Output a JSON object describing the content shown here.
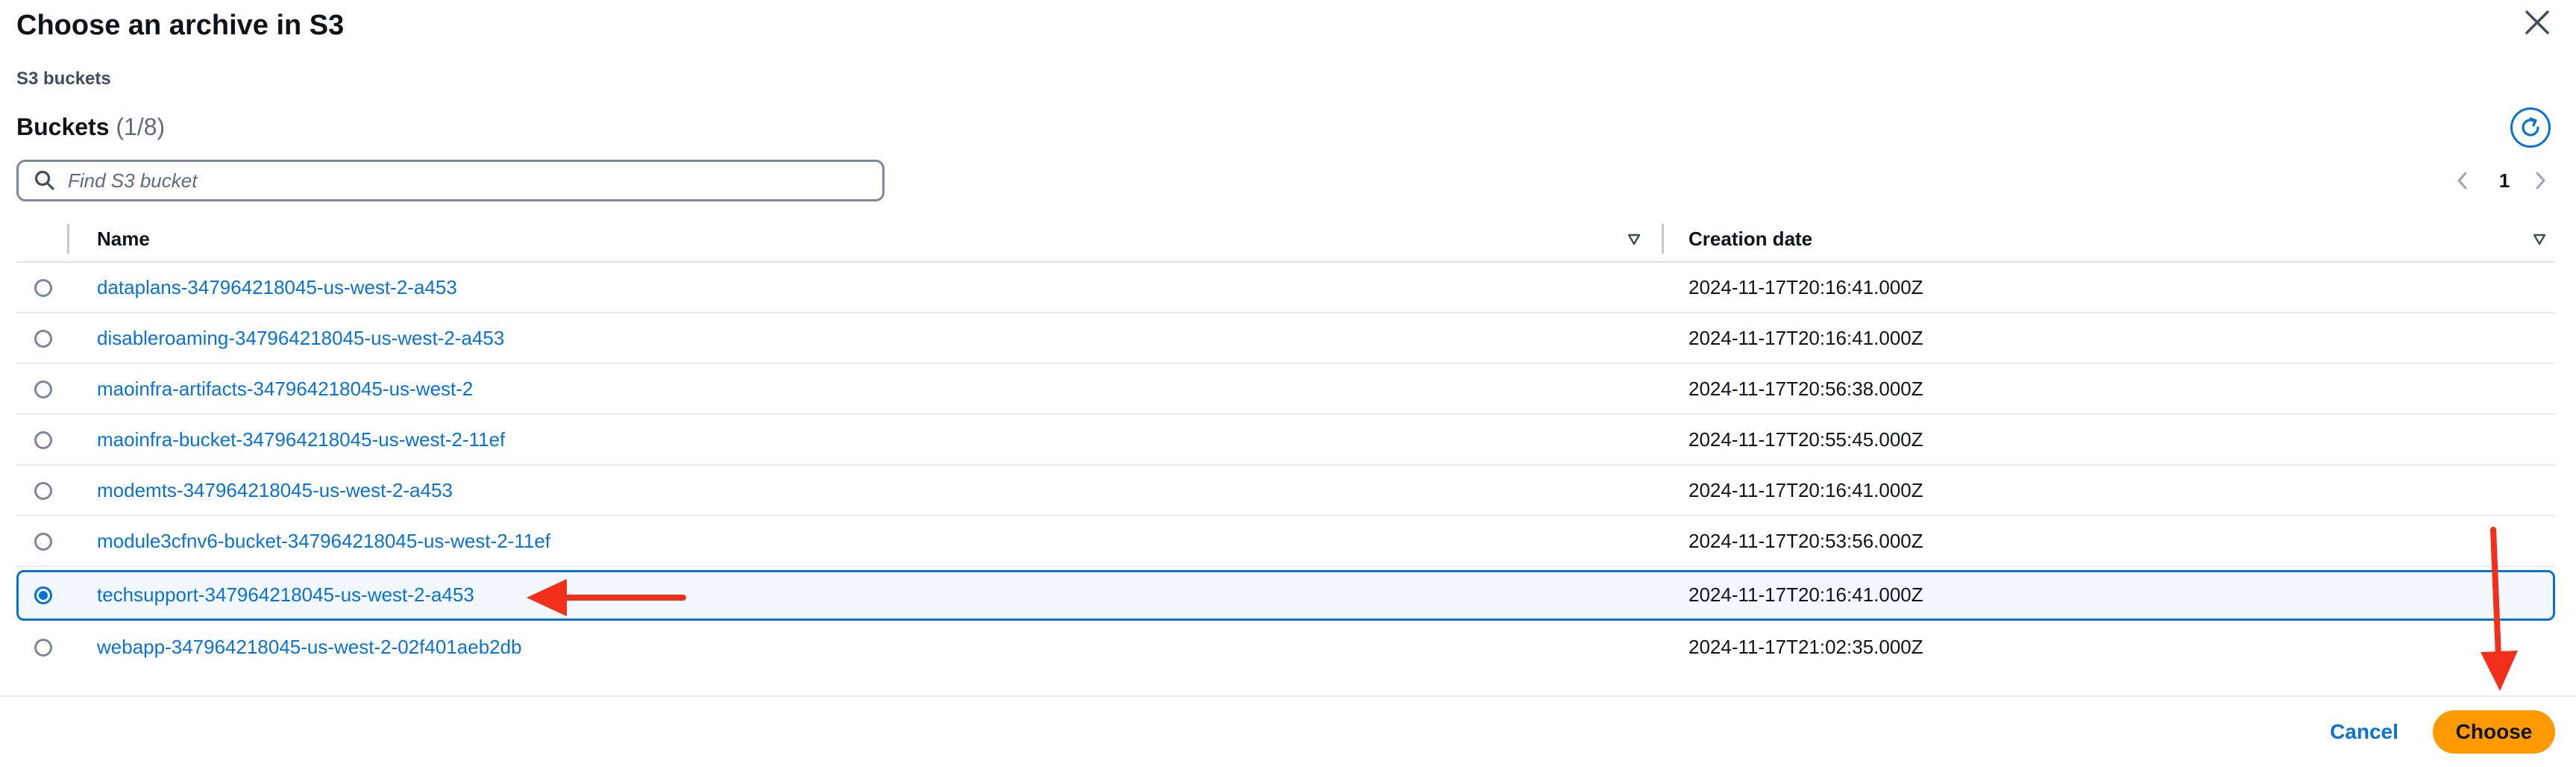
{
  "modal": {
    "title": "Choose an archive in S3"
  },
  "breadcrumb": "S3 buckets",
  "section": {
    "title": "Buckets",
    "count": "(1/8)"
  },
  "search": {
    "placeholder": "Find S3 bucket",
    "value": ""
  },
  "pagination": {
    "current_page": "1"
  },
  "table": {
    "columns": [
      "Name",
      "Creation date"
    ],
    "rows": [
      {
        "name": "dataplans-347964218045-us-west-2-a453",
        "created": "2024-11-17T20:16:41.000Z",
        "selected": false
      },
      {
        "name": "disableroaming-347964218045-us-west-2-a453",
        "created": "2024-11-17T20:16:41.000Z",
        "selected": false
      },
      {
        "name": "maoinfra-artifacts-347964218045-us-west-2",
        "created": "2024-11-17T20:56:38.000Z",
        "selected": false
      },
      {
        "name": "maoinfra-bucket-347964218045-us-west-2-11ef",
        "created": "2024-11-17T20:55:45.000Z",
        "selected": false
      },
      {
        "name": "modemts-347964218045-us-west-2-a453",
        "created": "2024-11-17T20:16:41.000Z",
        "selected": false
      },
      {
        "name": "module3cfnv6-bucket-347964218045-us-west-2-11ef",
        "created": "2024-11-17T20:53:56.000Z",
        "selected": false
      },
      {
        "name": "techsupport-347964218045-us-west-2-a453",
        "created": "2024-11-17T20:16:41.000Z",
        "selected": true
      },
      {
        "name": "webapp-347964218045-us-west-2-02f401aeb2db",
        "created": "2024-11-17T21:02:35.000Z",
        "selected": false
      }
    ]
  },
  "footer": {
    "cancel_label": "Cancel",
    "choose_label": "Choose"
  },
  "colors": {
    "link": "#0972d3",
    "primary_button": "#ff9900",
    "annotation_arrow": "#f0301b",
    "selected_row_bg": "#f2f8fd"
  },
  "icons": [
    "close-icon",
    "refresh-icon",
    "search-icon",
    "chevron-left-icon",
    "chevron-right-icon",
    "sort-icon"
  ]
}
